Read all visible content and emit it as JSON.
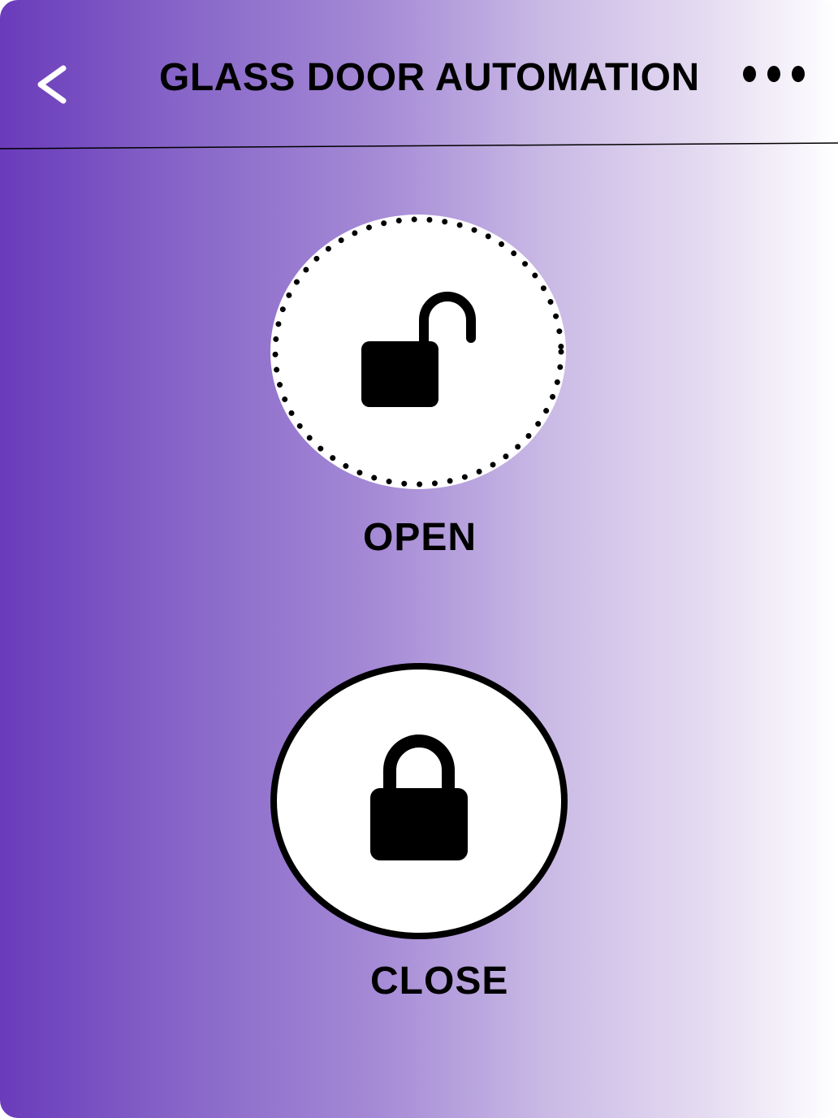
{
  "header": {
    "title": "GLASS DOOR AUTOMATION",
    "back_icon": "chevron-left-icon",
    "more_icon": "more-horizontal-icon"
  },
  "controls": {
    "open": {
      "label": "OPEN",
      "icon": "lock-open-icon",
      "state": "selected"
    },
    "close": {
      "label": "CLOSE",
      "icon": "lock-closed-icon",
      "state": "default"
    }
  },
  "colors": {
    "gradient_start": "#6a3bbb",
    "gradient_end": "#ffffff",
    "foreground": "#000000"
  }
}
